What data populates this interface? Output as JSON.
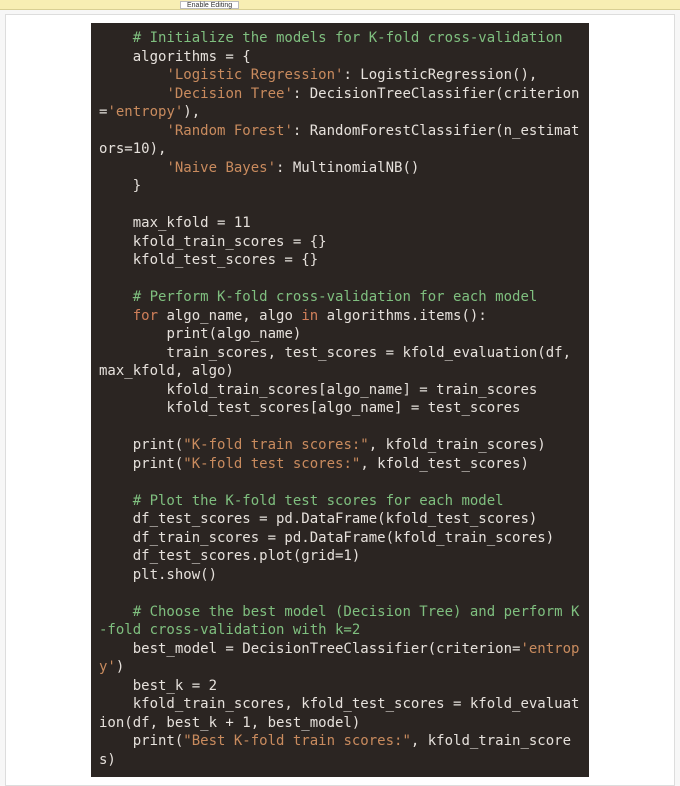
{
  "warning": {
    "button_label": "Enable Editing"
  },
  "code": {
    "tokens": [
      {
        "cls": "c-comment",
        "t": "    # Initialize the models for K-fold cross-validation\n"
      },
      {
        "cls": "",
        "t": "    algorithms = {\n"
      },
      {
        "cls": "",
        "t": "        "
      },
      {
        "cls": "c-str",
        "t": "'Logistic Regression'"
      },
      {
        "cls": "",
        "t": ": LogisticRegression(),\n"
      },
      {
        "cls": "",
        "t": "        "
      },
      {
        "cls": "c-str",
        "t": "'Decision Tree'"
      },
      {
        "cls": "",
        "t": ": DecisionTreeClassifier(criterion="
      },
      {
        "cls": "c-str",
        "t": "'entropy'"
      },
      {
        "cls": "",
        "t": "),\n"
      },
      {
        "cls": "",
        "t": "        "
      },
      {
        "cls": "c-str",
        "t": "'Random Forest'"
      },
      {
        "cls": "",
        "t": ": RandomForestClassifier(n_estimators=10),\n"
      },
      {
        "cls": "",
        "t": "        "
      },
      {
        "cls": "c-str",
        "t": "'Naive Bayes'"
      },
      {
        "cls": "",
        "t": ": MultinomialNB()\n"
      },
      {
        "cls": "",
        "t": "    }\n"
      },
      {
        "cls": "",
        "t": "\n"
      },
      {
        "cls": "",
        "t": "    max_kfold = 11\n"
      },
      {
        "cls": "",
        "t": "    kfold_train_scores = {}\n"
      },
      {
        "cls": "",
        "t": "    kfold_test_scores = {}\n"
      },
      {
        "cls": "",
        "t": "\n"
      },
      {
        "cls": "c-comment",
        "t": "    # Perform K-fold cross-validation for each model\n"
      },
      {
        "cls": "",
        "t": "    "
      },
      {
        "cls": "c-kw",
        "t": "for"
      },
      {
        "cls": "",
        "t": " algo_name, algo "
      },
      {
        "cls": "c-kw",
        "t": "in"
      },
      {
        "cls": "",
        "t": " algorithms.items():\n"
      },
      {
        "cls": "",
        "t": "        print(algo_name)\n"
      },
      {
        "cls": "",
        "t": "        train_scores, test_scores = kfold_evaluation(df, max_kfold, algo)\n"
      },
      {
        "cls": "",
        "t": "        kfold_train_scores[algo_name] = train_scores\n"
      },
      {
        "cls": "",
        "t": "        kfold_test_scores[algo_name] = test_scores\n"
      },
      {
        "cls": "",
        "t": "\n"
      },
      {
        "cls": "",
        "t": "    print("
      },
      {
        "cls": "c-str",
        "t": "\"K-fold train scores:\""
      },
      {
        "cls": "",
        "t": ", kfold_train_scores)\n"
      },
      {
        "cls": "",
        "t": "    print("
      },
      {
        "cls": "c-str",
        "t": "\"K-fold test scores:\""
      },
      {
        "cls": "",
        "t": ", kfold_test_scores)\n"
      },
      {
        "cls": "",
        "t": "\n"
      },
      {
        "cls": "c-comment",
        "t": "    # Plot the K-fold test scores for each model\n"
      },
      {
        "cls": "",
        "t": "    df_test_scores = pd.DataFrame(kfold_test_scores)\n"
      },
      {
        "cls": "",
        "t": "    df_train_scores = pd.DataFrame(kfold_train_scores)\n"
      },
      {
        "cls": "",
        "t": "    df_test_scores.plot(grid=1)\n"
      },
      {
        "cls": "",
        "t": "    plt.show()\n"
      },
      {
        "cls": "",
        "t": "\n"
      },
      {
        "cls": "c-comment",
        "t": "    # Choose the best model (Decision Tree) and perform K-fold cross-validation with k=2\n"
      },
      {
        "cls": "",
        "t": "    best_model = DecisionTreeClassifier(criterion="
      },
      {
        "cls": "c-str",
        "t": "'entropy'"
      },
      {
        "cls": "",
        "t": ")\n"
      },
      {
        "cls": "",
        "t": "    best_k = 2\n"
      },
      {
        "cls": "",
        "t": "    kfold_train_scores, kfold_test_scores = kfold_evaluation(df, best_k + 1, best_model)\n"
      },
      {
        "cls": "",
        "t": "    print("
      },
      {
        "cls": "c-str",
        "t": "\"Best K-fold train scores:\""
      },
      {
        "cls": "",
        "t": ", kfold_train_scores)"
      }
    ]
  }
}
